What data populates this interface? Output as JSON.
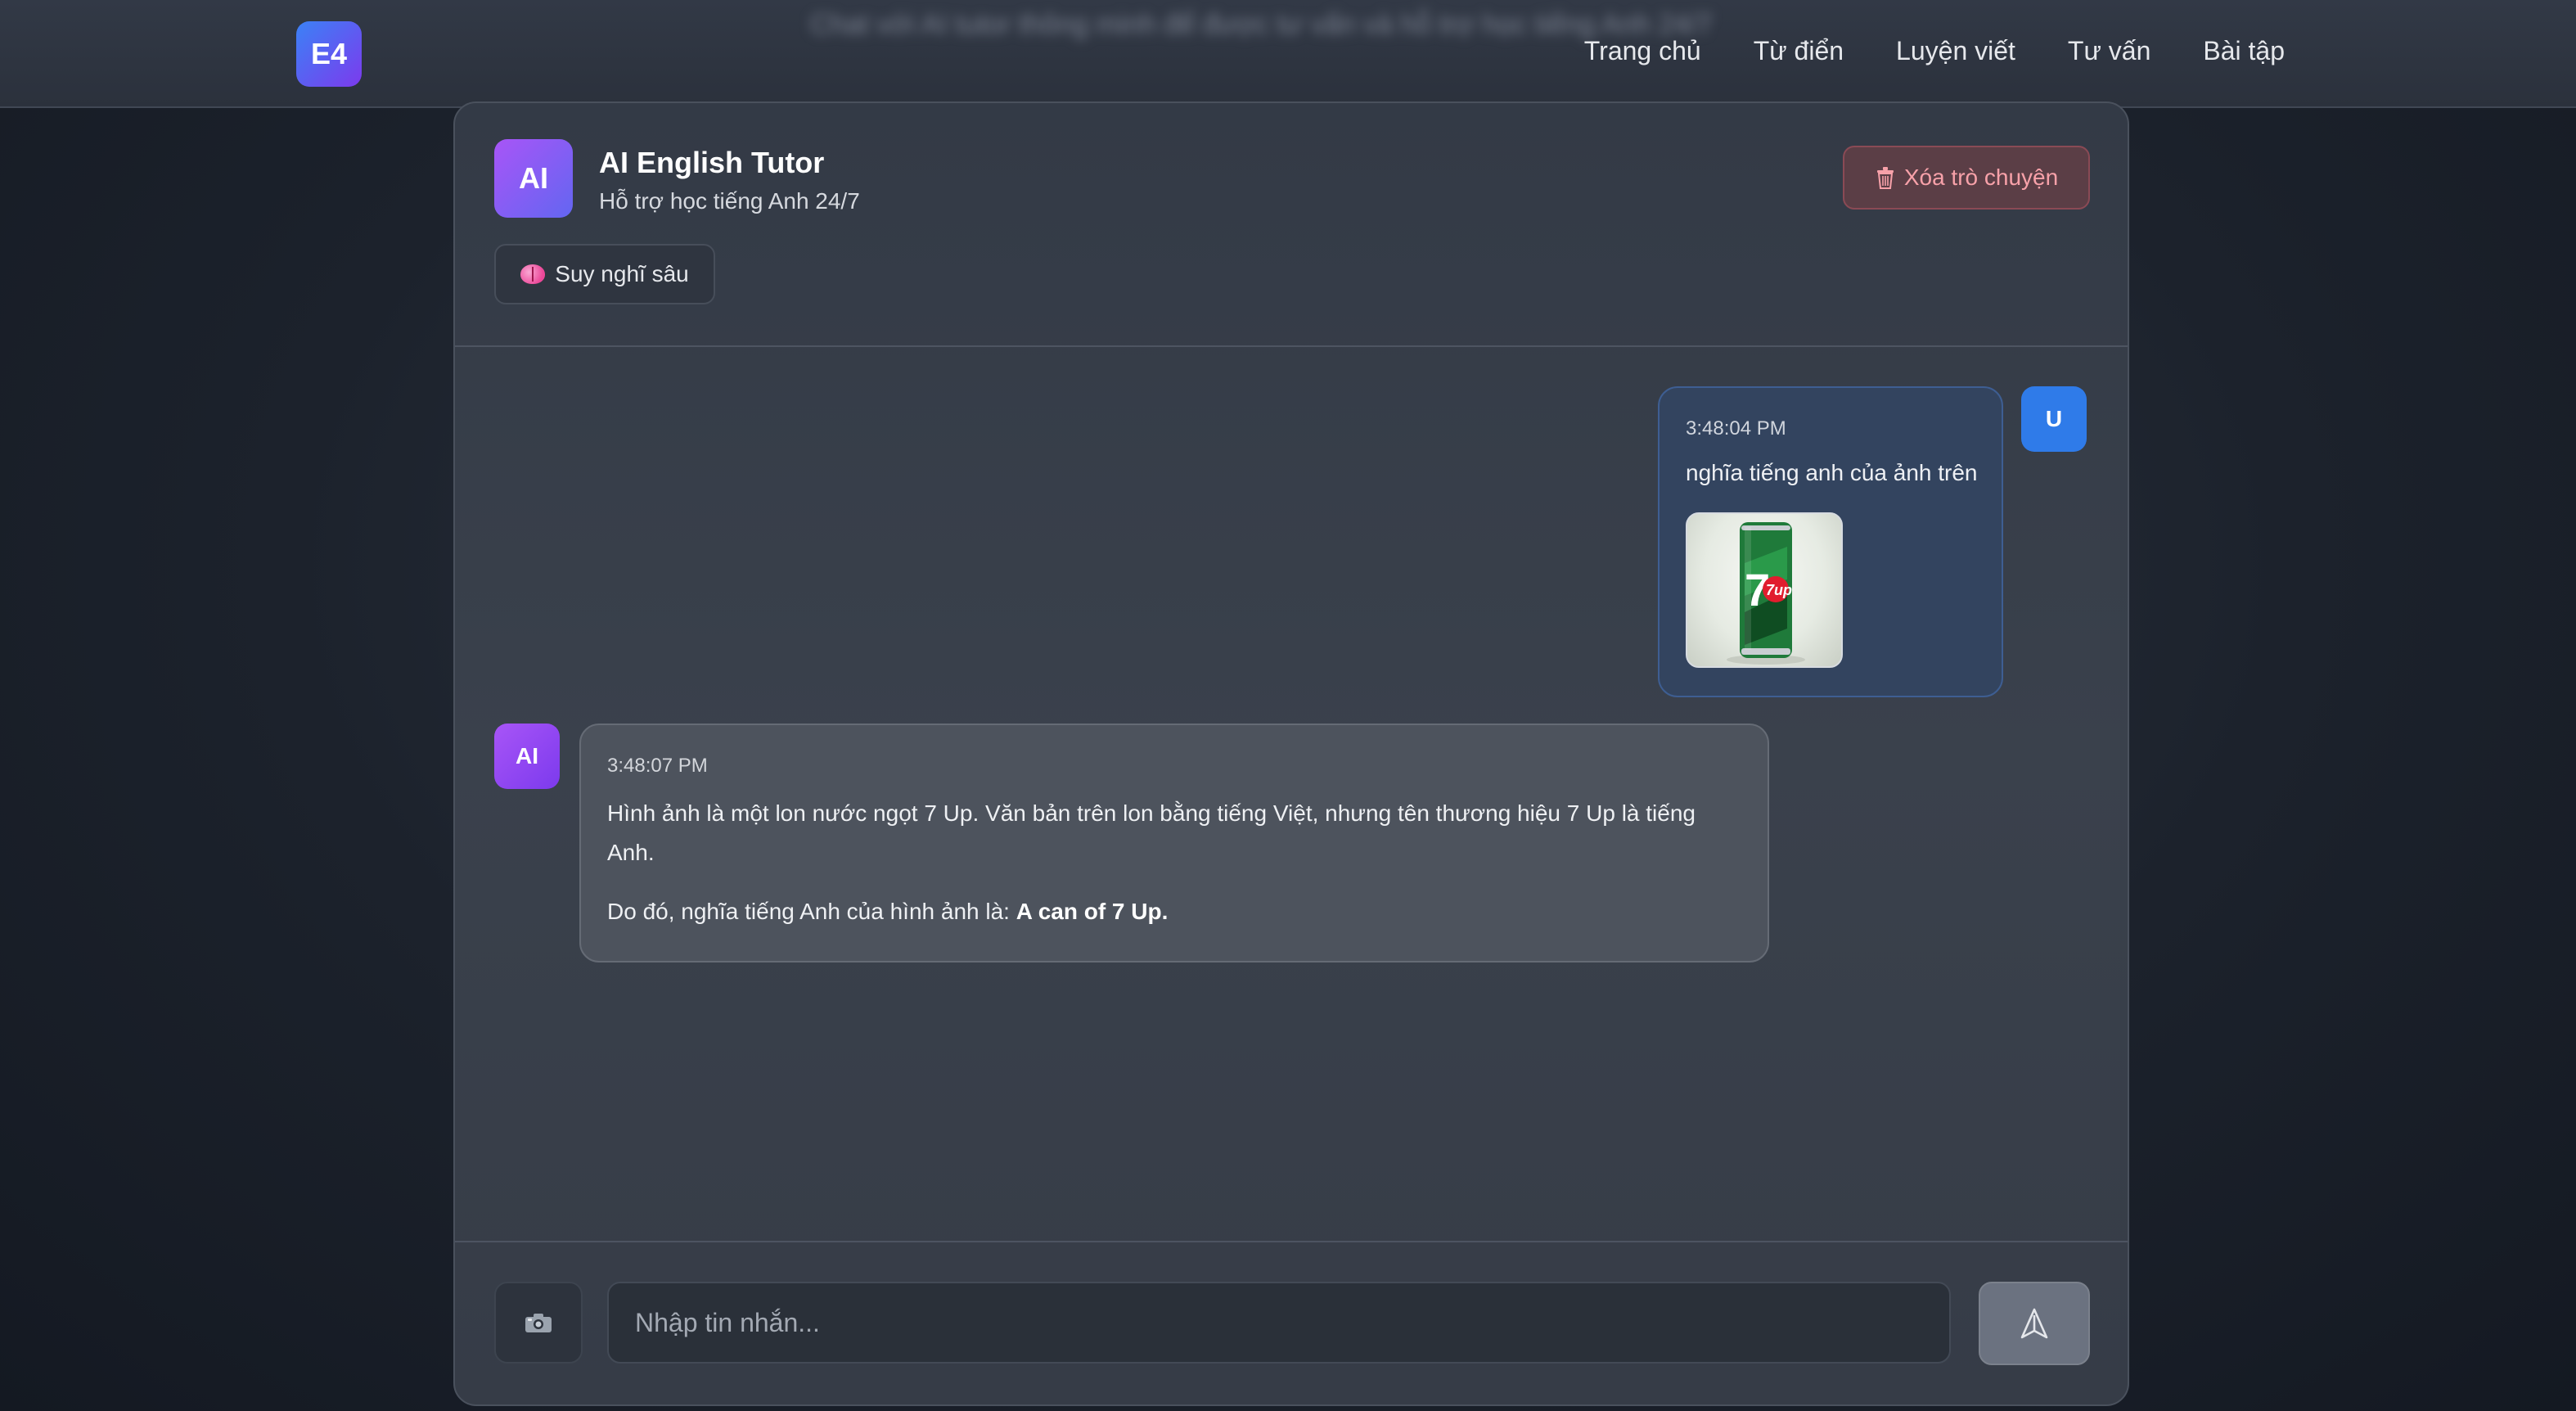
{
  "header": {
    "tagline": "Chat với AI tutor thông minh để được tư vấn và hỗ trợ học tiếng Anh 24/7",
    "logo": "E4",
    "nav": [
      "Trang chủ",
      "Từ điển",
      "Luyện viết",
      "Tư vấn",
      "Bài tập"
    ]
  },
  "chat": {
    "avatar": "AI",
    "title": "AI English Tutor",
    "subtitle": "Hỗ trợ học tiếng Anh 24/7",
    "clear_label": "Xóa trò chuyện",
    "think_label": "Suy nghĩ sâu",
    "clear_icon": "trash-icon",
    "think_icon": "brain-icon"
  },
  "messages": {
    "user": {
      "avatar": "U",
      "time": "3:48:04 PM",
      "text": "nghĩa tiếng anh của ảnh trên",
      "image_label": "7up"
    },
    "ai": {
      "avatar": "AI",
      "time": "3:48:07 PM",
      "p1": "Hình ảnh là một lon nước ngọt 7 Up. Văn bản trên lon bằng tiếng Việt, nhưng tên thương hiệu 7 Up là tiếng Anh.",
      "p2_prefix": "Do đó, nghĩa tiếng Anh của hình ảnh là: ",
      "p2_bold": "A can of 7 Up."
    }
  },
  "composer": {
    "placeholder": "Nhập tin nhắn...",
    "camera_icon": "camera-icon",
    "send_icon": "send-icon"
  },
  "colors": {
    "accent_blue": "#2f7be9",
    "accent_purple": "#a855f7",
    "danger": "#f7a1a9",
    "user_bubble": "#33445f",
    "ai_bubble": "#4d535d"
  }
}
